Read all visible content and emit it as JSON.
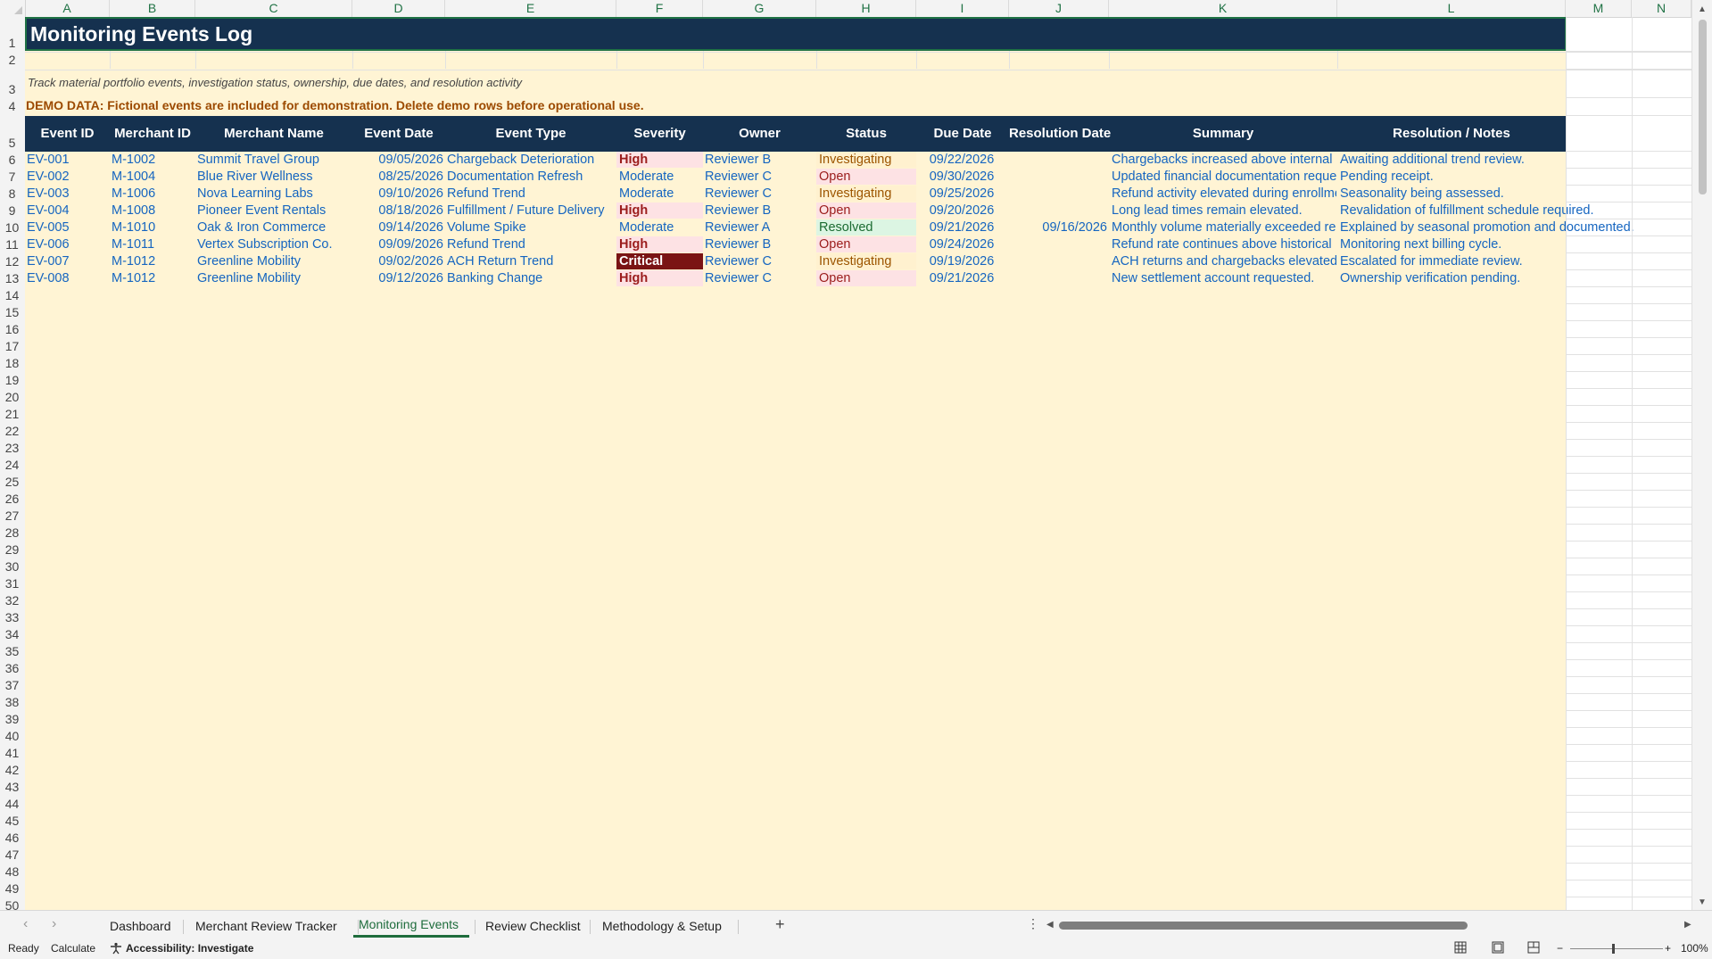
{
  "columns": [
    "A",
    "B",
    "C",
    "D",
    "E",
    "F",
    "G",
    "H",
    "I",
    "J",
    "K",
    "L",
    "M",
    "N"
  ],
  "rows": [
    "1",
    "2",
    "3",
    "4",
    "5",
    "6",
    "7",
    "8",
    "9",
    "10",
    "11",
    "12",
    "13",
    "14",
    "15",
    "16",
    "17",
    "18",
    "19",
    "20",
    "21",
    "22",
    "23",
    "24",
    "25",
    "26",
    "27",
    "28",
    "29",
    "30",
    "31",
    "32",
    "33",
    "34",
    "35",
    "36",
    "37",
    "38",
    "39",
    "40",
    "41",
    "42",
    "43",
    "44",
    "45",
    "46",
    "47",
    "48",
    "49",
    "50"
  ],
  "sheet": {
    "title": "Monitoring Events Log",
    "subtitle": "Track material portfolio events, investigation status, ownership, due dates, and resolution activity",
    "demo_notice": "DEMO DATA: Fictional events are included for demonstration. Delete demo rows before operational use.",
    "headers": [
      "Event ID",
      "Merchant ID",
      "Merchant Name",
      "Event Date",
      "Event Type",
      "Severity",
      "Owner",
      "Status",
      "Due Date",
      "Resolution Date",
      "Summary",
      "Resolution / Notes"
    ],
    "events": [
      {
        "id": "EV-001",
        "merchant_id": "M-1002",
        "merchant_name": "Summit Travel Group",
        "event_date": "09/05/2026",
        "event_type": "Chargeback Deterioration",
        "severity": "High",
        "owner": "Reviewer B",
        "status": "Investigating",
        "due_date": "09/22/2026",
        "resolution_date": "",
        "summary": "Chargebacks increased above internal",
        "notes": "Awaiting additional trend review."
      },
      {
        "id": "EV-002",
        "merchant_id": "M-1004",
        "merchant_name": "Blue River Wellness",
        "event_date": "08/25/2026",
        "event_type": "Documentation Refresh",
        "severity": "Moderate",
        "owner": "Reviewer C",
        "status": "Open",
        "due_date": "09/30/2026",
        "resolution_date": "",
        "summary": "Updated financial documentation reque",
        "notes": "Pending receipt."
      },
      {
        "id": "EV-003",
        "merchant_id": "M-1006",
        "merchant_name": "Nova Learning Labs",
        "event_date": "09/10/2026",
        "event_type": "Refund Trend",
        "severity": "Moderate",
        "owner": "Reviewer C",
        "status": "Investigating",
        "due_date": "09/25/2026",
        "resolution_date": "",
        "summary": "Refund activity elevated during enrollme",
        "notes": "Seasonality being assessed."
      },
      {
        "id": "EV-004",
        "merchant_id": "M-1008",
        "merchant_name": "Pioneer Event Rentals",
        "event_date": "08/18/2026",
        "event_type": "Fulfillment / Future Delivery",
        "severity": "High",
        "owner": "Reviewer B",
        "status": "Open",
        "due_date": "09/20/2026",
        "resolution_date": "",
        "summary": "Long lead times remain elevated.",
        "notes": "Revalidation of fulfillment schedule required."
      },
      {
        "id": "EV-005",
        "merchant_id": "M-1010",
        "merchant_name": "Oak & Iron Commerce",
        "event_date": "09/14/2026",
        "event_type": "Volume Spike",
        "severity": "Moderate",
        "owner": "Reviewer A",
        "status": "Resolved",
        "due_date": "09/21/2026",
        "resolution_date": "09/16/2026",
        "summary": "Monthly volume materially exceeded re",
        "notes": "Explained by seasonal promotion and documented."
      },
      {
        "id": "EV-006",
        "merchant_id": "M-1011",
        "merchant_name": "Vertex Subscription Co.",
        "event_date": "09/09/2026",
        "event_type": "Refund Trend",
        "severity": "High",
        "owner": "Reviewer B",
        "status": "Open",
        "due_date": "09/24/2026",
        "resolution_date": "",
        "summary": "Refund rate continues above historical",
        "notes": "Monitoring next billing cycle."
      },
      {
        "id": "EV-007",
        "merchant_id": "M-1012",
        "merchant_name": "Greenline Mobility",
        "event_date": "09/02/2026",
        "event_type": "ACH Return Trend",
        "severity": "Critical",
        "owner": "Reviewer C",
        "status": "Investigating",
        "due_date": "09/19/2026",
        "resolution_date": "",
        "summary": "ACH returns and chargebacks elevated",
        "notes": "Escalated for immediate review."
      },
      {
        "id": "EV-008",
        "merchant_id": "M-1012",
        "merchant_name": "Greenline Mobility",
        "event_date": "09/12/2026",
        "event_type": "Banking Change",
        "severity": "High",
        "owner": "Reviewer C",
        "status": "Open",
        "due_date": "09/21/2026",
        "resolution_date": "",
        "summary": "New settlement account requested.",
        "notes": "Ownership verification pending."
      }
    ]
  },
  "tabs": [
    {
      "label": "Dashboard"
    },
    {
      "label": "Merchant Review Tracker"
    },
    {
      "label": "Monitoring Events",
      "active": true
    },
    {
      "label": "Review Checklist"
    },
    {
      "label": "Methodology & Setup"
    }
  ],
  "tab_add_label": "+",
  "tab_more_label": "⋮",
  "status": {
    "ready": "Ready",
    "calculate": "Calculate",
    "accessibility": "Accessibility: Investigate",
    "zoom": "100%"
  },
  "colors": {
    "header_fill": "#15314f",
    "band_fill": "#fff4d4",
    "link_blue": "#1565c0",
    "high_bg": "#fde2e4",
    "high_fg": "#9b1c1c",
    "critical_bg": "#7a1414",
    "open_bg": "#fde2e4",
    "investigating_bg": "#fff1cf",
    "resolved_bg": "#dcf5e3",
    "accent_green": "#1e6c3c"
  },
  "icons": {
    "accessibility": "accessibility-icon",
    "normal_view": "normal-view-icon",
    "page_layout": "page-layout-icon",
    "page_break": "page-break-icon"
  }
}
